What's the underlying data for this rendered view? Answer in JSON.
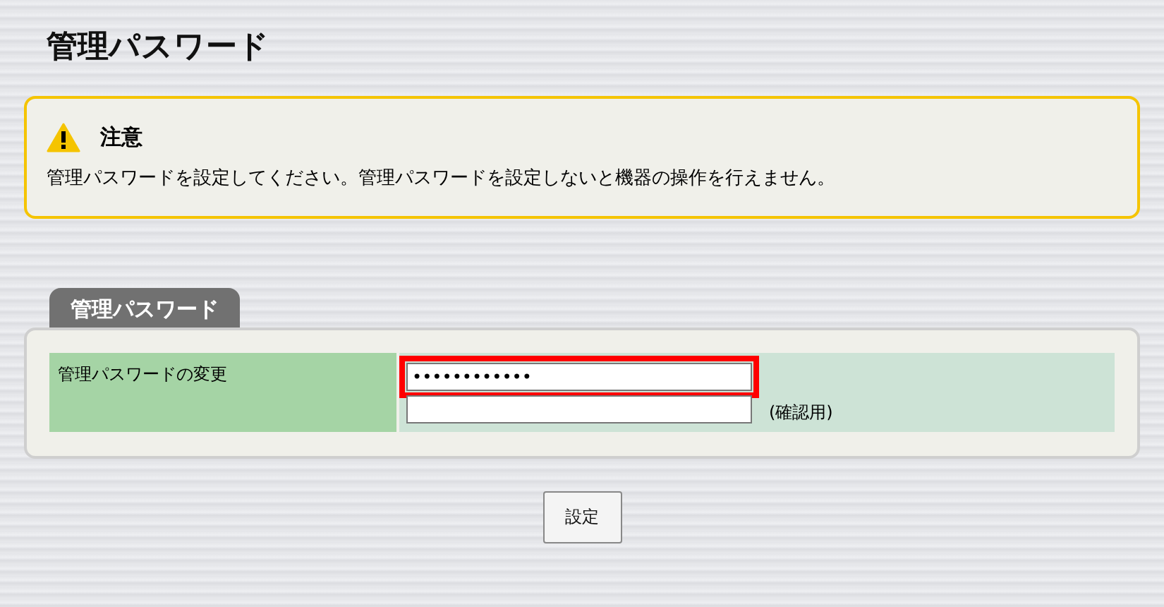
{
  "page_title": "管理パスワード",
  "notice": {
    "title": "注意",
    "message": "管理パスワードを設定してください。管理パスワードを設定しないと機器の操作を行えません。"
  },
  "section": {
    "tab": "管理パスワード",
    "rows": [
      {
        "label": "管理パスワードの変更",
        "fields": [
          {
            "value": "••••••••••••",
            "highlighted": true
          },
          {
            "highlighted": false,
            "note": "(確認用)"
          }
        ]
      }
    ]
  },
  "buttons": [
    "設定"
  ]
}
